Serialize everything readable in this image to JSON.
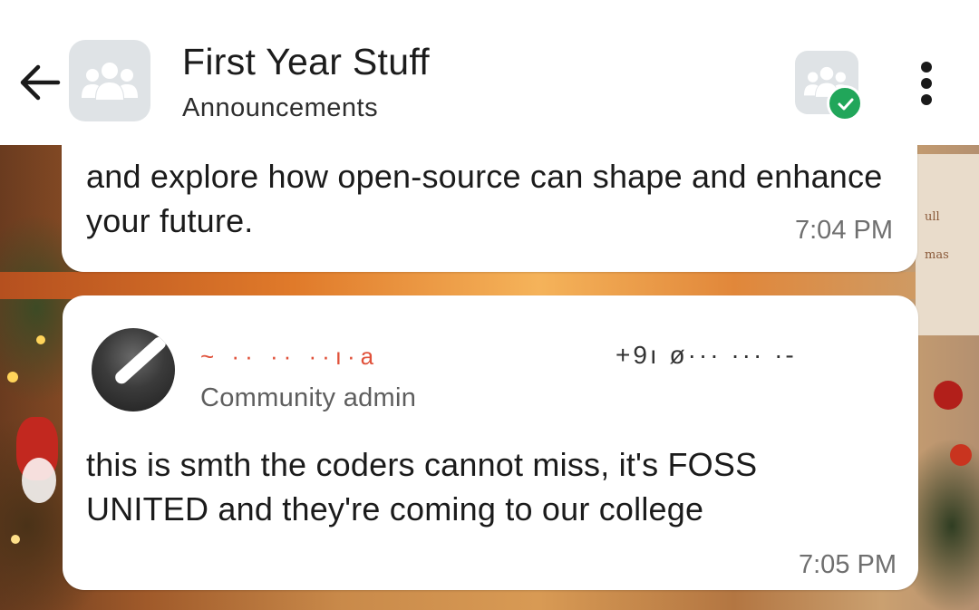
{
  "header": {
    "back_icon": "arrow-left-icon",
    "group_icon": "group-people-icon",
    "title": "First Year Stuff",
    "subtitle": "Announcements",
    "community_icon": "community-people-icon",
    "badge_icon": "check-badge-icon",
    "menu_icon": "more-vertical-icon"
  },
  "wallpaper": {
    "labels": [
      "ull",
      "mas"
    ]
  },
  "messages": [
    {
      "text": "and explore how open-source can shape and enhance your future.",
      "time": "7:04 PM"
    },
    {
      "sender_name": "~ ·· ·· ··ı·a",
      "sender_phone": "+9ı ø··· ··· ·-",
      "sender_role": "Community admin",
      "text": "this is smth the coders cannot miss, it's FOSS UNITED and they're coming to our college",
      "time": "7:05 PM"
    }
  ],
  "colors": {
    "accent_green": "#21a65a",
    "sender_name": "#e0513a",
    "avatar_bg": "#dfe3e6"
  }
}
